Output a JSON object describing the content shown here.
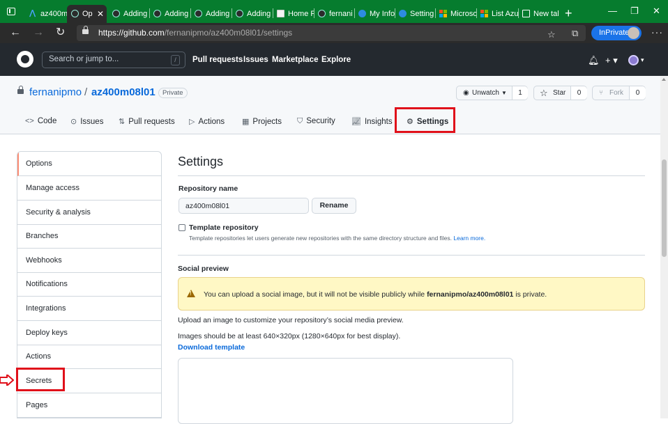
{
  "browser": {
    "tabs": [
      {
        "title": "az400m",
        "favicon": "azure-devops-icon"
      },
      {
        "title": "Op",
        "favicon": "github-icon",
        "active": true
      },
      {
        "title": "Adding",
        "favicon": "github-icon"
      },
      {
        "title": "Adding",
        "favicon": "github-icon"
      },
      {
        "title": "Adding",
        "favicon": "github-icon"
      },
      {
        "title": "Adding",
        "favicon": "github-icon"
      },
      {
        "title": "Home F",
        "favicon": "page-icon"
      },
      {
        "title": "fernani",
        "favicon": "github-icon"
      },
      {
        "title": "My Info",
        "favicon": "edge-icon"
      },
      {
        "title": "Setting",
        "favicon": "edge-icon"
      },
      {
        "title": "Microso",
        "favicon": "microsoft-icon"
      },
      {
        "title": "List Azu",
        "favicon": "microsoft-icon"
      },
      {
        "title": "New tal",
        "favicon": "new-tab-icon"
      }
    ],
    "url_host": "https://github.com",
    "url_path": "/fernanipmo/az400m08l01/settings",
    "inprivate_label": "InPrivate"
  },
  "github": {
    "search_placeholder": "Search or jump to...",
    "search_shortcut": "/",
    "nav": [
      "Pull requests",
      "Issues",
      "Marketplace",
      "Explore"
    ]
  },
  "repo": {
    "owner": "fernanipmo",
    "separator": "/",
    "name": "az400m08l01",
    "visibility": "Private",
    "unwatch_label": "Unwatch",
    "unwatch_count": "1",
    "star_label": "Star",
    "star_count": "0",
    "fork_label": "Fork",
    "fork_count": "0",
    "tabs": [
      "Code",
      "Issues",
      "Pull requests",
      "Actions",
      "Projects",
      "Security",
      "Insights",
      "Settings"
    ]
  },
  "sidebar": {
    "items": [
      "Options",
      "Manage access",
      "Security & analysis",
      "Branches",
      "Webhooks",
      "Notifications",
      "Integrations",
      "Deploy keys",
      "Actions",
      "Secrets",
      "Pages"
    ]
  },
  "settings": {
    "title": "Settings",
    "repo_name_label": "Repository name",
    "repo_name_value": "az400m08l01",
    "rename_button": "Rename",
    "template_label": "Template repository",
    "template_note": "Template repositories let users generate new repositories with the same directory structure and files.",
    "learn_more": "Learn more.",
    "social_preview_label": "Social preview",
    "flash_prefix": "You can upload a social image, but it will not be visible publicly while",
    "flash_repo": "fernanipmo/az400m08l01",
    "flash_suffix": "is private.",
    "upload_text": "Upload an image to customize your repository’s social media preview.",
    "size_text": "Images should be at least 640×320px (1280×640px for best display).",
    "download_template": "Download template"
  },
  "colors": {
    "highlight_red": "#e0101a",
    "link_blue": "#0969da",
    "active_orange": "#fd8c73",
    "browser_green": "#067c2e"
  }
}
